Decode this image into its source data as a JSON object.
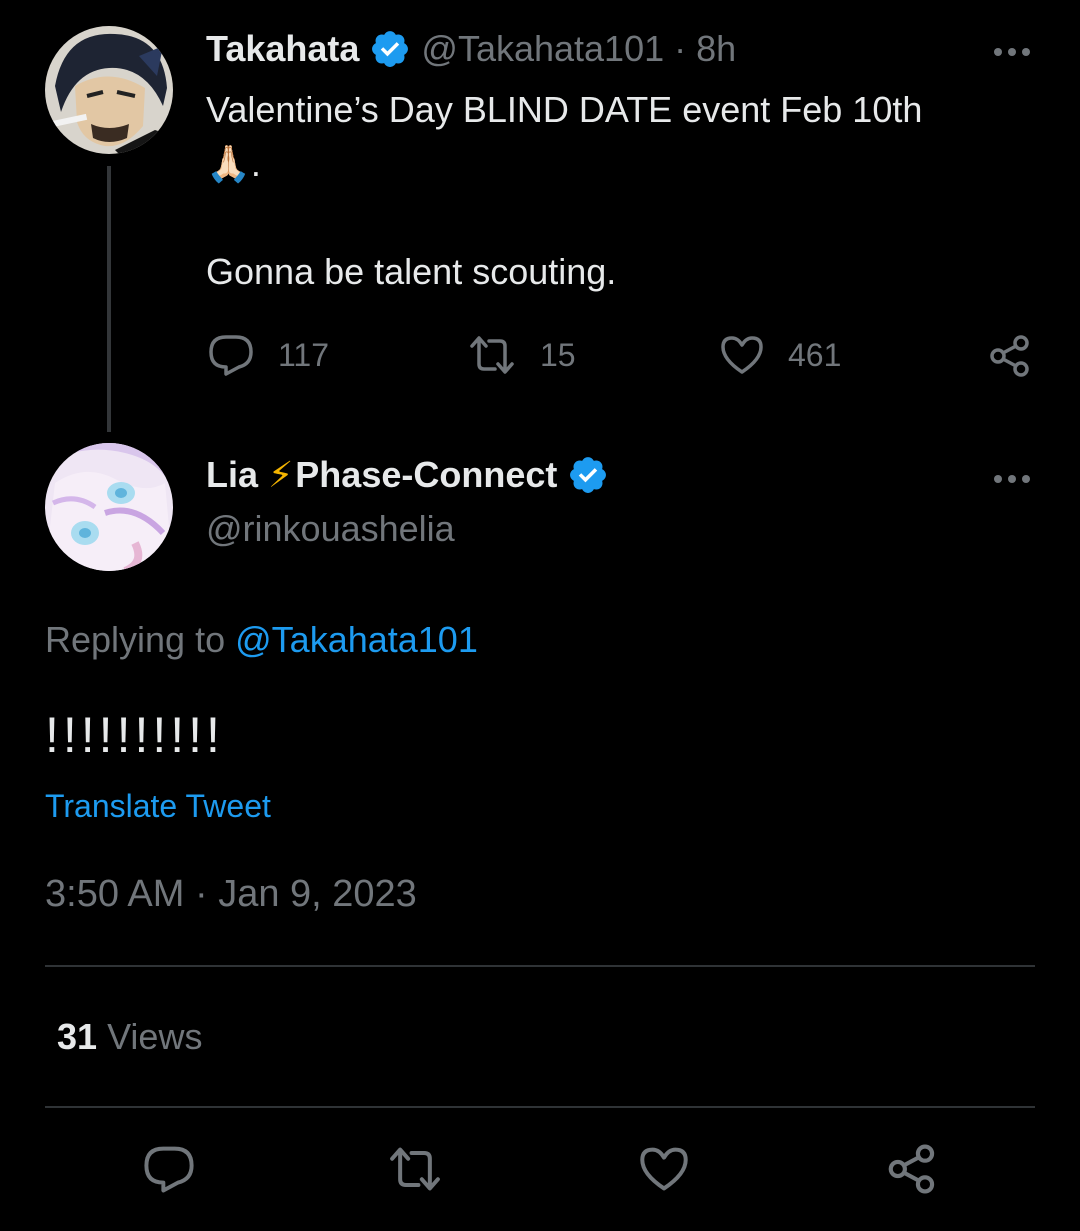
{
  "parent_tweet": {
    "author_name": "Takahata",
    "author_handle": "@Takahata101",
    "separator": "·",
    "age": "8h",
    "text_line1": "Valentine’s Day BLIND DATE event Feb 10th",
    "text_line2": "🙏🏻.",
    "text_line3": "Gonna be talent scouting.",
    "replies": "117",
    "retweets": "15",
    "likes": "461"
  },
  "main_tweet": {
    "author_name": "Lia",
    "author_emoji": "⚡",
    "author_name_suffix": "Phase-Connect",
    "author_handle": "@rinkouashelia",
    "replying_prefix": "Replying to",
    "replying_mention": "@Takahata101",
    "text": "!!!!!!!!!!",
    "translate_label": "Translate Tweet",
    "timestamp": "3:50 AM · Jan 9, 2023",
    "views_count": "31",
    "views_label": "Views"
  },
  "colors": {
    "background": "#000000",
    "primary_text": "#e7e9ea",
    "secondary_text": "#71767b",
    "accent": "#1d9bf0",
    "divider": "#2f3336"
  },
  "icons": {
    "verified": "verified-badge-icon",
    "more": "more-horizontal-icon",
    "reply": "reply-icon",
    "retweet": "retweet-icon",
    "like": "heart-icon",
    "share": "share-icon"
  }
}
